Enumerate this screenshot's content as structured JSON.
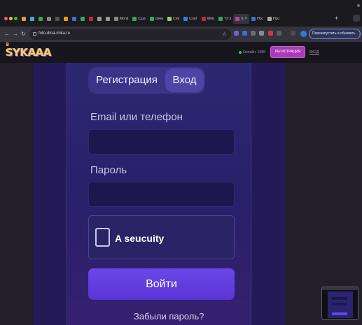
{
  "browser": {
    "tabs": [
      {
        "label": "",
        "color": "#e0a030"
      },
      {
        "label": "",
        "color": "#4aa3df"
      },
      {
        "label": "",
        "color": "#34a853"
      },
      {
        "label": "",
        "color": "#888888"
      },
      {
        "label": "",
        "color": "#555555"
      },
      {
        "label": "",
        "color": "#f29900"
      },
      {
        "label": "",
        "color": "#3b6fd6"
      },
      {
        "label": "",
        "color": "#34a853"
      },
      {
        "label": "",
        "color": "#c62828"
      },
      {
        "label": "",
        "color": "#999999"
      },
      {
        "label": "",
        "color": "#999999"
      },
      {
        "label": "Monit",
        "color": "#888888"
      },
      {
        "label": "Сша",
        "color": "#34a853"
      },
      {
        "label": "смен",
        "color": "#34a853"
      },
      {
        "label": "Спи",
        "color": "#9ccc65"
      },
      {
        "label": "Слот",
        "color": "#1e88e5"
      },
      {
        "label": "Web",
        "color": "#c62828"
      },
      {
        "label": "ТЗ 3",
        "color": "#34a853"
      }
    ],
    "active_tab": {
      "label": "S",
      "close": "×"
    },
    "tabs_after": [
      {
        "label": "Пос",
        "color": "#3b6fd6"
      },
      {
        "label": "Про",
        "color": "#aaaaaa"
      }
    ],
    "new_tab": "+",
    "url": "foto-dina-mika.ru",
    "relaunch_label": "Перезапустить и обновить",
    "relaunch_menu": "⋮"
  },
  "site": {
    "logo": "SYKAAA",
    "online_label": "Онлайн: 1589",
    "register_button": "РЕГИСТРАЦИЯ",
    "login_link": "ВХОД"
  },
  "form": {
    "tab_register": "Регистрация",
    "tab_login": "Вход",
    "email_label": "Email или телефон",
    "email_value": "",
    "password_label": "Пароль",
    "password_value": "",
    "captcha_text": "A seucuity",
    "submit_label": "Войти",
    "forgot_link": "Забыли пароль?"
  },
  "colors": {
    "accent": "#5a35d6",
    "register_button": "#a93ab8",
    "online_dot": "#2ecc40"
  }
}
